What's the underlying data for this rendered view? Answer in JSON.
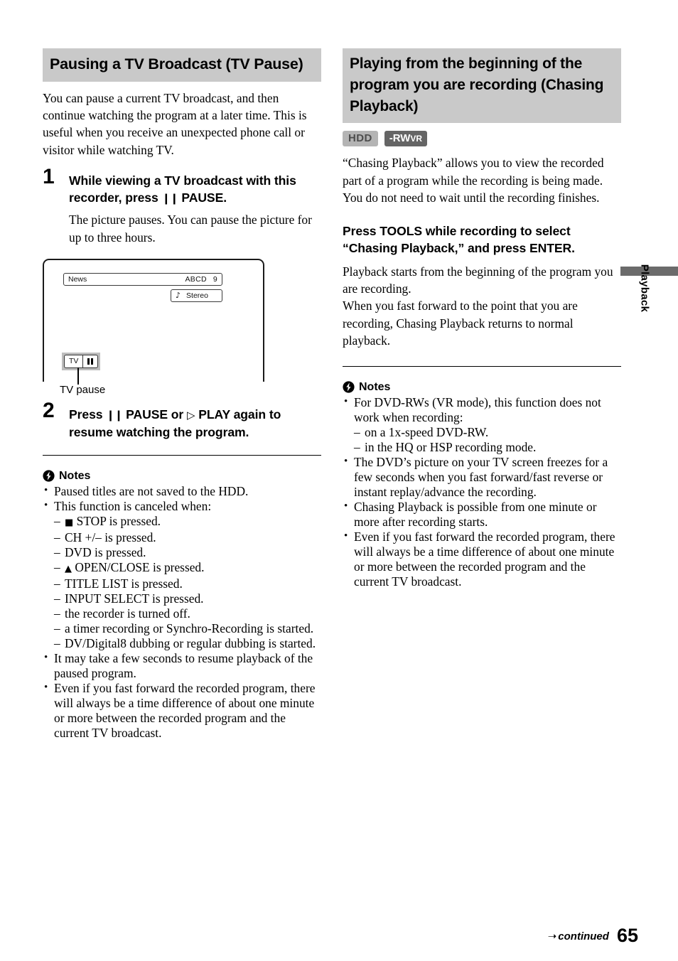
{
  "left": {
    "heading": "Pausing a TV Broadcast (TV Pause)",
    "intro": "You can pause a current TV broadcast, and then continue watching the program at a later time. This is useful when you receive an unexpected phone call or visitor while watching TV.",
    "step1": {
      "number": "1",
      "title_a": "While viewing a TV broadcast with this recorder, press",
      "title_pause_glyph": "❙❙",
      "title_b": "PAUSE.",
      "body": "The picture pauses. You can pause the picture for up to three hours."
    },
    "figure": {
      "program_title": "News",
      "channel_name": "ABCD",
      "channel_number": "9",
      "audio_icon": "music-note-icon",
      "audio_label": "Stereo",
      "source_label": "TV",
      "status_icon": "pause-icon",
      "caption": "TV pause"
    },
    "step2": {
      "number": "2",
      "title_a": "Press",
      "pause_glyph": "❙❙",
      "title_b": "PAUSE or",
      "play_glyph": "▷",
      "title_c": "PLAY again to resume watching the program."
    },
    "notes": {
      "icon": "flash-circle-icon",
      "label": "Notes",
      "items": [
        {
          "text": "Paused titles are not saved to the HDD.",
          "sub": []
        },
        {
          "text": "This function is canceled when:",
          "sub": [
            "■ STOP is pressed.",
            "CH +/– is pressed.",
            "DVD is pressed.",
            "⏏ OPEN/CLOSE is pressed.",
            "TITLE LIST is pressed.",
            "INPUT SELECT is pressed.",
            "the recorder is turned off.",
            "a timer recording or Synchro-Recording is started.",
            "DV/Digital8 dubbing or regular dubbing is started."
          ]
        },
        {
          "text": "It may take a few seconds to resume playback of the paused program.",
          "sub": []
        },
        {
          "text": "Even if you fast forward the recorded program, there will always be a time difference of about one minute or more between the recorded program and the current TV broadcast.",
          "sub": []
        }
      ]
    }
  },
  "right": {
    "heading": "Playing from the beginning of the program you are recording (Chasing Playback)",
    "badges": [
      {
        "name": "HDD",
        "kind": "hdd"
      },
      {
        "name": "-RW",
        "suffix": "VR",
        "kind": "rw"
      }
    ],
    "intro": "“Chasing Playback” allows you to view the recorded part of a program while the recording is being made. You do not need to wait until the recording finishes.",
    "sub_heading": "Press TOOLS while recording to select “Chasing Playback,” and press ENTER.",
    "body": "Playback starts from the beginning of the program you are recording.\nWhen you fast forward to the point that you are recording, Chasing Playback returns to normal playback.",
    "notes": {
      "icon": "flash-circle-icon",
      "label": "Notes",
      "items": [
        {
          "text": "For DVD-RWs (VR mode), this function does not work when recording:",
          "sub": [
            "on a 1x-speed DVD-RW.",
            "in the HQ or HSP recording mode."
          ]
        },
        {
          "text": "The DVD’s picture on your TV screen freezes for a few seconds when you fast forward/fast reverse or instant replay/advance the recording.",
          "sub": []
        },
        {
          "text": "Chasing Playback is possible from one minute or more after recording starts.",
          "sub": []
        },
        {
          "text": "Even if you fast forward the recorded program, there will always be a time difference of about one minute or more between the recorded program and the current TV broadcast.",
          "sub": []
        }
      ]
    }
  },
  "side_tab": {
    "label": "Playback"
  },
  "footer": {
    "arrow_icon": "arrow-right-icon",
    "continued": "continued",
    "page_number": "65"
  },
  "colors": {
    "band": "#c9c9c9",
    "badge_hdd_bg": "#b4b4b4",
    "badge_hdd_fg": "#4d4d4d",
    "badge_rw_bg": "#656565",
    "badge_rw_fg": "#ffffff",
    "side_tab_bar": "#6b6b6b"
  }
}
